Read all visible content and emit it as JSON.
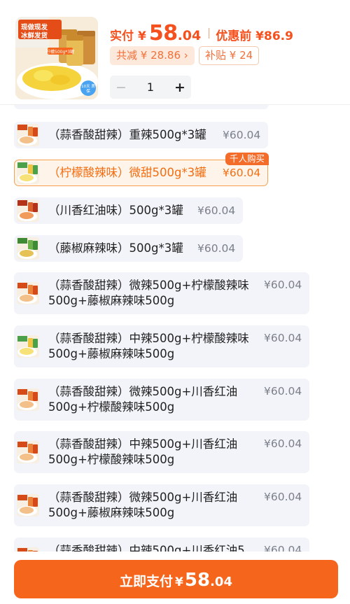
{
  "summary": {
    "pay_label": "实付",
    "currency": "¥",
    "pay_int": "58",
    "pay_dec": ".04",
    "original_price": "优惠前 ¥86.9",
    "reduce_tag": "共减 ¥ 28.86 ›",
    "subsidy_tag": "补贴 ¥ 24",
    "quantity": "1",
    "minus": "−",
    "plus": "+"
  },
  "product_image": {
    "text_lines": [
      "现做现发",
      "冰鲜发货"
    ],
    "jar_label": "柠檬500g*3罐",
    "badge": "10天 质保"
  },
  "options": [
    {
      "text": "（蒜香酸甜辣）重辣500g*3罐",
      "price": "¥60.04",
      "thumb": "garlic",
      "selected": false,
      "badge": ""
    },
    {
      "text": "（柠檬酸辣味）微甜500g*3罐",
      "price": "¥60.04",
      "thumb": "lemon",
      "selected": true,
      "badge": "千人购买"
    },
    {
      "text": "（川香红油味）500g*3罐",
      "price": "¥60.04",
      "thumb": "chili",
      "selected": false,
      "badge": ""
    },
    {
      "text": "（藤椒麻辣味）500g*3罐",
      "price": "¥60.04",
      "thumb": "pepper",
      "selected": false,
      "badge": ""
    },
    {
      "text": "（蒜香酸甜辣）微辣500g+柠檬酸辣味500g+藤椒麻辣味500g",
      "price": "¥60.04",
      "thumb": "garlic",
      "selected": false,
      "badge": ""
    },
    {
      "text": "（蒜香酸甜辣）中辣500g+柠檬酸辣味500g+藤椒麻辣味500g",
      "price": "¥60.04",
      "thumb": "lemon",
      "selected": false,
      "badge": ""
    },
    {
      "text": "（蒜香酸甜辣）微辣500g+川香红油500g+柠檬酸辣味500g",
      "price": "¥60.04",
      "thumb": "garlic",
      "selected": false,
      "badge": ""
    },
    {
      "text": "（蒜香酸甜辣）中辣500g+川香红油500g+柠檬酸辣味500g",
      "price": "¥60.04",
      "thumb": "garlic",
      "selected": false,
      "badge": ""
    },
    {
      "text": "（蒜香酸甜辣）微辣500g+川香红油500g+藤椒麻辣味500g",
      "price": "¥60.04",
      "thumb": "garlic",
      "selected": false,
      "badge": ""
    },
    {
      "text": "（蒜香酸甜辣）中辣500g+川香红油5",
      "price": "¥60.04",
      "thumb": "garlic",
      "selected": false,
      "badge": ""
    }
  ],
  "pay_button": {
    "label": "立即支付",
    "currency": "¥",
    "int": "58",
    "dec": ".04"
  },
  "colors": {
    "accent": "#f5661c",
    "selected_border": "#f6a14f",
    "option_bg": "#f2f4f9"
  }
}
